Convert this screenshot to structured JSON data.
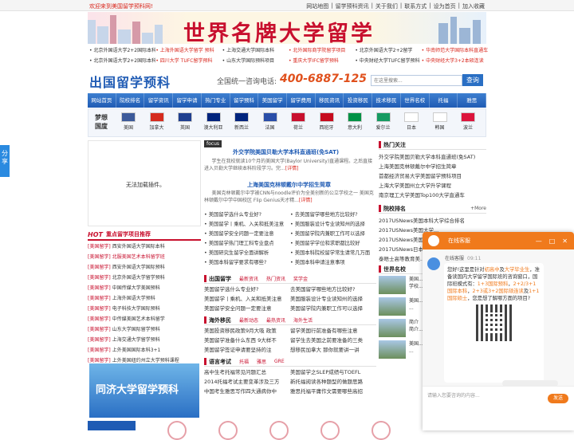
{
  "topbar": {
    "welcome": "欢迎来到美国留学预科网!",
    "links": [
      "网站地图",
      "|",
      "留学预科资讯",
      "|",
      "关于我们",
      "|",
      "联系方式",
      "|",
      "设为首页",
      "|",
      "加入收藏"
    ]
  },
  "banner": {
    "title": "世界名牌大学留学"
  },
  "link_rows": [
    [
      {
        "t": "北京外国语大学2+2国际本科",
        "red": false
      },
      {
        "t": "上海外国语大学留学 预科",
        "red": true
      },
      {
        "t": "上海交通大学国际本科",
        "red": false
      },
      {
        "t": "北外国际商学院留学项目",
        "red": true
      },
      {
        "t": "北京外国语大学2+2留学",
        "red": false
      },
      {
        "t": "华南师范大学国际本科直通车",
        "red": true
      }
    ],
    [
      {
        "t": "北京外国语大学2+2国际本科项目",
        "red": false
      },
      {
        "t": "四川大学 TUFC留学预科",
        "red": true
      },
      {
        "t": "山东大学国际预科项目",
        "red": false
      },
      {
        "t": "重庆大学IFC留学预科",
        "red": true
      },
      {
        "t": "中央财经大学TUFC留学预科",
        "red": false
      },
      {
        "t": "中央财经大学3+2本硕连读",
        "red": true
      }
    ]
  ],
  "logo": "出国留学预科",
  "hotline": {
    "label": "全国统一咨询电话:",
    "number": "400-6887-125"
  },
  "search": {
    "placeholder": "在这里搜索...",
    "button": "查询"
  },
  "nav": [
    "网站首页",
    "院校排名",
    "留学资讯",
    "留学申请",
    "热门专业",
    "留学预科",
    "美国留学",
    "留学费用",
    "移民资讯",
    "投资移民",
    "技术移民",
    "世界名校",
    "托福",
    "雅思"
  ],
  "flags": {
    "dream_label": "梦想国度",
    "countries": [
      {
        "name": "美国",
        "c": "#3c5a9a"
      },
      {
        "name": "加拿大",
        "c": "#d52b1e"
      },
      {
        "name": "英国",
        "c": "#1f3f8f"
      },
      {
        "name": "澳大利亚",
        "c": "#00247d"
      },
      {
        "name": "新西兰",
        "c": "#00247d"
      },
      {
        "name": "法国",
        "c": "#2a4ea8"
      },
      {
        "name": "荷兰",
        "c": "#c8102e"
      },
      {
        "name": "西班牙",
        "c": "#c60b1e"
      },
      {
        "name": "意大利",
        "c": "#009246"
      },
      {
        "name": "爱尔兰",
        "c": "#169b62"
      },
      {
        "name": "日本",
        "c": "#ffffff"
      },
      {
        "name": "韩国",
        "c": "#ffffff"
      },
      {
        "name": "波兰",
        "c": "#dc143c"
      }
    ]
  },
  "share": "分享",
  "ad_placeholder": "无法加载插件。",
  "focus": {
    "label": "focus",
    "items": [
      {
        "title": "外交学院美国贝勒大学本科直通班(免SAT)",
        "desc": "学生在我校就读10个月的美国大学(Baylor University)直通课程。之后直接进入贝勒大学继续本科阶段学习。完...",
        "more": "[详情]"
      },
      {
        "title": "上海美国克林顿戴尔中学招生简章",
        "desc": "美国克林顿戴尔中学被CNN与noodle评价为全美创新的公立学校之一 美国克林顿戴尔中学中国校区 Flip Genius天才精...",
        "more": "[详情]"
      }
    ]
  },
  "focus_list": [
    [
      "美国留学选什么专业好?",
      "去美国留学哪些地方比较好?"
    ],
    [
      "美国留学丨乘机、入关和抵美注意",
      "美国服装设计专业读知州的选择"
    ],
    [
      "美国留学安全问题一定要注意",
      "美国留学院内兼职工作可以选择"
    ],
    [
      "美国留学热门理工科专业盘点",
      "美国留学学位和求职都比较好"
    ],
    [
      "美国研究生留学全面讲解析",
      "美国本科院校留学常生请常几万面"
    ],
    [
      "美国本科留学要求有哪些?",
      "美国本科申请注意事项"
    ]
  ],
  "sections": [
    {
      "title": "出国留学",
      "tabs": [
        "最新资讯",
        "热门资讯",
        "奖学金"
      ],
      "items": [
        [
          "美国留学选什么专业好?",
          "去美国留学哪些地方比较好?"
        ],
        [
          "美国留学丨乘机、入关和抵美注意",
          "美国服装设计专业读知州的选择"
        ],
        [
          "美国留学安全问题一定要注意",
          "美国留学院内兼职工作可以选择"
        ]
      ]
    },
    {
      "title": "海外移民",
      "tabs": [
        "最新动态",
        "最热资讯",
        "海外生活"
      ],
      "items": [
        [
          "美国投资移民政策9月大吸 政策",
          "留学美国行前准备有哪些注意"
        ],
        [
          "美国留学准备什么东西 9大样不",
          "留学生去美国之前要准备的三类"
        ],
        [
          "美国留学签证申请要坚持的注",
          "想移民加拿大 那你就要讲一讲"
        ]
      ]
    },
    {
      "title": "语言考试",
      "tabs": [
        "托福",
        "雅思",
        "GRE"
      ],
      "items": [
        [
          "高中生考托福常见问题汇总",
          "美国留学之SLEP成绩与TOEFL"
        ],
        [
          "2014托福考试主要变革涉及三方",
          "新托福阅读各种题型的做题思路"
        ],
        [
          "中国考生雅思写作四大通病你中",
          "雅思托福平庸作文需要哪些高招"
        ]
      ]
    }
  ],
  "hot_recommend": {
    "hot_label": "HOT",
    "title": "重点留学项目推荐",
    "items": [
      {
        "tag": "[美国留学]",
        "t": "西安外国语大学国际本科",
        "red": false
      },
      {
        "tag": "[美国留学]",
        "t": "北服美国艺术本科留学班",
        "red": true
      },
      {
        "tag": "[美国留学]",
        "t": "西安外国语大学国际预科",
        "red": false
      },
      {
        "tag": "[美国留学]",
        "t": "北京外国语大学留学预科",
        "red": false
      },
      {
        "tag": "[美国留学]",
        "t": "中国传媒大学美国预科",
        "red": false
      },
      {
        "tag": "[美国留学]",
        "t": "上海外国语大学预科",
        "red": false
      },
      {
        "tag": "[美国留学]",
        "t": "电子科技大学国际预科",
        "red": false
      },
      {
        "tag": "[美国留学]",
        "t": "中传媒美国艺术本科留学",
        "red": false
      },
      {
        "tag": "[美国留学]",
        "t": "山东大学国际留学预科",
        "red": false
      },
      {
        "tag": "[美国留学]",
        "t": "上海交通大学留学预科",
        "red": false
      },
      {
        "tag": "[美国留学]",
        "t": "上外美国国际本科3+1",
        "red": false
      },
      {
        "tag": "[美国留学]",
        "t": "上外美国纽约州立大学预科课程",
        "red": false
      }
    ]
  },
  "tongji_banner": "同济大学留学预科",
  "right": {
    "hot_title": "热门关注",
    "hot_items": [
      "外交学院美国贝勒大学本科直通班(免SAT)",
      "上海美国克林顿戴尔中学招生简章",
      "首都经济贸易大学美国留学预科项目",
      "上海大学美国州立大学升学课程",
      "南京理工大学美国Top100大学直通车"
    ],
    "rank_title": "院校排名",
    "rank_more": "+More",
    "rank_items": [
      "2017USNews美国本科大学综合排名",
      "2017USNews美国大学...",
      "2017USNews美国大学...",
      "2017USNews日本大学...",
      "泰晤士高等教育美..."
    ],
    "school_title": "世界名校",
    "schools": [
      {
        "name": "美国...",
        "desc": "学校..."
      },
      {
        "name": "美国...",
        "desc": "..."
      },
      {
        "name": "简介",
        "desc": "简介..."
      },
      {
        "name": "美国...",
        "desc": "..."
      }
    ]
  },
  "chat": {
    "title": "在线客服",
    "agent": "在线客服",
    "time": "09:11",
    "message": [
      "您好!这里是针对",
      "初高中",
      "及",
      "大学毕业生",
      "，准备读国内大学留学国际班的咨询窗口，国际班模式有：",
      "1+3国际预科",
      "，",
      "2+2/3+1国际本科",
      "，",
      "2+3或3+2国际硕连读",
      "及",
      "1+1国际硕士",
      "，您是想了解哪方面的项目?"
    ],
    "input_placeholder": "请输入您要咨询的内容...",
    "send": "发送",
    "ctrls": [
      "—",
      "□",
      "✕"
    ]
  }
}
